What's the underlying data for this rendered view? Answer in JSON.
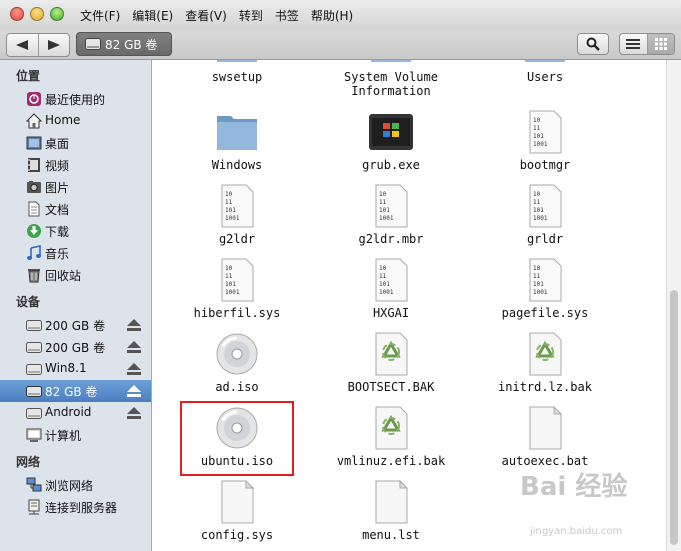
{
  "menu": [
    "文件(F)",
    "编辑(E)",
    "查看(V)",
    "转到",
    "书签",
    "帮助(H)"
  ],
  "toolbar": {
    "back_icon": "back-arrow-icon",
    "forward_icon": "forward-arrow-icon",
    "path_label": "82 GB 卷",
    "search_icon": "magnifier-icon"
  },
  "sidebar": {
    "sections": [
      {
        "label": "位置",
        "items": [
          {
            "label": "最近使用的",
            "icon": "recent-icon"
          },
          {
            "label": "Home",
            "icon": "home-icon"
          },
          {
            "label": "桌面",
            "icon": "desktop-icon"
          },
          {
            "label": "视频",
            "icon": "video-icon"
          },
          {
            "label": "图片",
            "icon": "picture-icon"
          },
          {
            "label": "文档",
            "icon": "document-icon"
          },
          {
            "label": "下载",
            "icon": "download-icon"
          },
          {
            "label": "音乐",
            "icon": "music-icon"
          },
          {
            "label": "回收站",
            "icon": "trash-icon"
          }
        ]
      },
      {
        "label": "设备",
        "items": [
          {
            "label": "200 GB 卷",
            "icon": "drive-icon",
            "eject": true
          },
          {
            "label": "200 GB 卷",
            "icon": "drive-icon",
            "eject": true
          },
          {
            "label": "Win8.1",
            "icon": "drive-icon",
            "eject": true
          },
          {
            "label": "82 GB 卷",
            "icon": "drive-icon",
            "eject": true,
            "selected": true
          },
          {
            "label": "Android",
            "icon": "drive-icon",
            "eject": true
          },
          {
            "label": "计算机",
            "icon": "computer-icon"
          }
        ]
      },
      {
        "label": "网络",
        "items": [
          {
            "label": "浏览网络",
            "icon": "network-icon"
          },
          {
            "label": "连接到服务器",
            "icon": "server-icon"
          }
        ]
      }
    ]
  },
  "files": [
    {
      "name": "swsetup",
      "kind": "folder",
      "partial": true
    },
    {
      "name": "System Volume\nInformation",
      "kind": "folder",
      "partial": true
    },
    {
      "name": "Users",
      "kind": "folder",
      "partial": true
    },
    {
      "name": "Windows",
      "kind": "folder"
    },
    {
      "name": "grub.exe",
      "kind": "exe"
    },
    {
      "name": "bootmgr",
      "kind": "binary"
    },
    {
      "name": "g2ldr",
      "kind": "binary"
    },
    {
      "name": "g2ldr.mbr",
      "kind": "binary"
    },
    {
      "name": "grldr",
      "kind": "binary"
    },
    {
      "name": "hiberfil.sys",
      "kind": "binary"
    },
    {
      "name": "HXGAI",
      "kind": "binary"
    },
    {
      "name": "pagefile.sys",
      "kind": "binary"
    },
    {
      "name": "ad.iso",
      "kind": "disc"
    },
    {
      "name": "BOOTSECT.BAK",
      "kind": "recycle"
    },
    {
      "name": "initrd.lz.bak",
      "kind": "recycle"
    },
    {
      "name": "ubuntu.iso",
      "kind": "disc",
      "highlighted": true
    },
    {
      "name": "vmlinuz.efi.bak",
      "kind": "recycle"
    },
    {
      "name": "autoexec.bat",
      "kind": "blank"
    },
    {
      "name": "config.sys",
      "kind": "blank"
    },
    {
      "name": "menu.lst",
      "kind": "blank"
    }
  ],
  "watermark": {
    "brand": "Bai 经验",
    "url": "jingyan.baidu.com"
  },
  "colors": {
    "selection": "#4a7fc0",
    "highlight_border": "#e02020",
    "sidebar_bg": "#dde3ea"
  }
}
